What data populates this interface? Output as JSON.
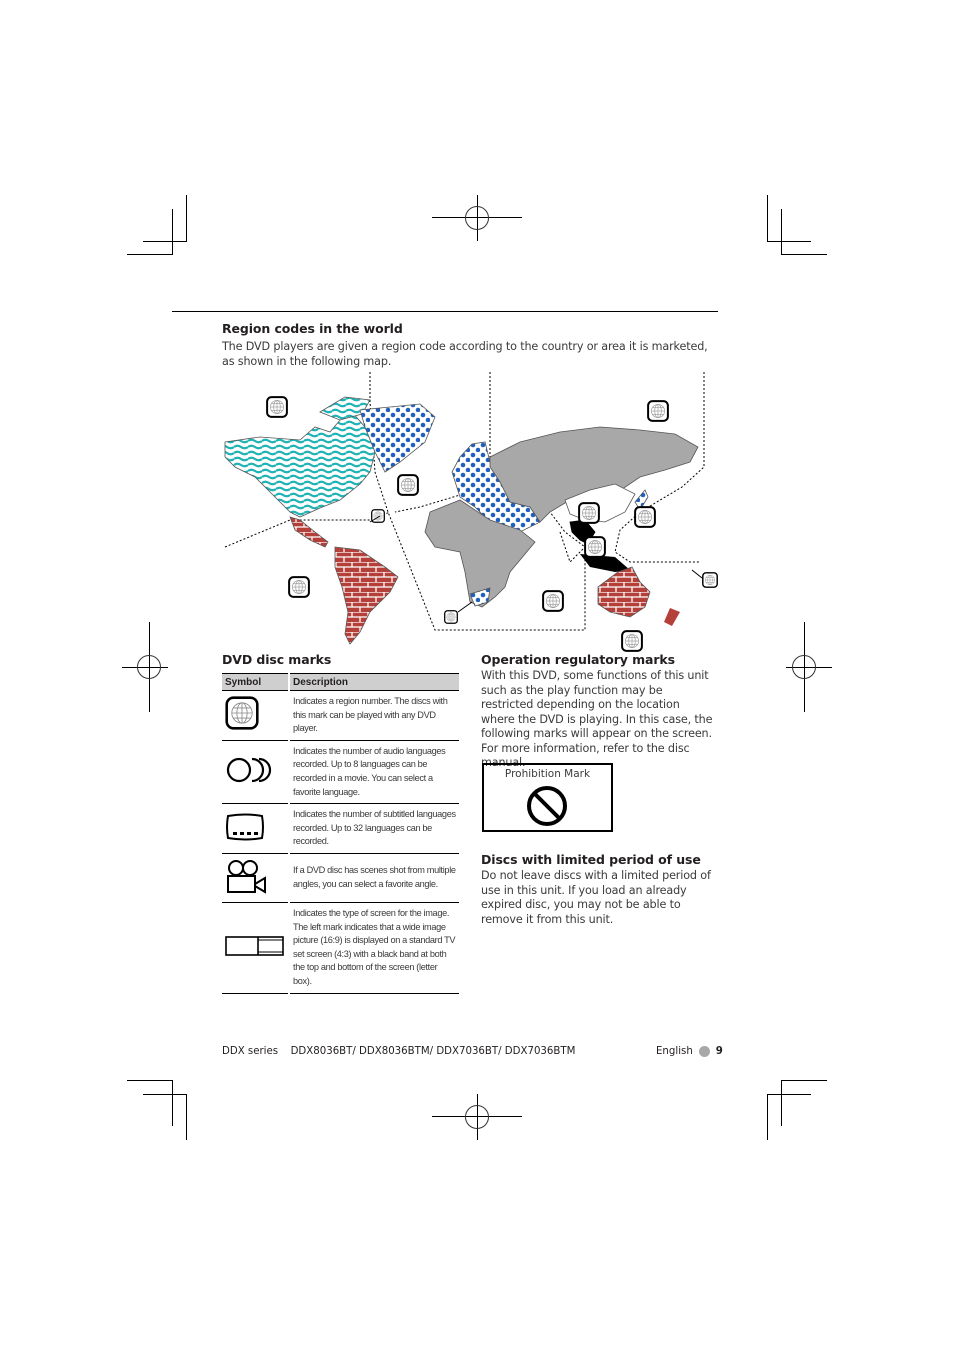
{
  "region_section": {
    "title": "Region codes in the world",
    "intro": "The DVD players are given a region code according to the country or area it is marketed, as shown in the following map."
  },
  "world_map": {
    "legend_colors": {
      "region1": "#1fb3b5",
      "region2": "#1f5fbf",
      "region3": "#000000",
      "region4": "#b5403a",
      "region5": "#a8a8a8",
      "region6": "#ffffff"
    },
    "region_markers": [
      {
        "region": "north-america"
      },
      {
        "region": "greenland"
      },
      {
        "region": "caribbean"
      },
      {
        "region": "south-america"
      },
      {
        "region": "europe"
      },
      {
        "region": "russia-north"
      },
      {
        "region": "china"
      },
      {
        "region": "southeast-asia"
      },
      {
        "region": "japan"
      },
      {
        "region": "south-africa"
      },
      {
        "region": "indian-ocean"
      },
      {
        "region": "pacific-islands"
      },
      {
        "region": "australia"
      }
    ]
  },
  "disc_marks": {
    "title": "DVD disc marks",
    "headers": {
      "symbol": "Symbol",
      "description": "Description"
    },
    "rows": [
      {
        "icon": "region-globe-icon",
        "description": "Indicates a region number. The discs with this mark can be played with any DVD player."
      },
      {
        "icon": "audio-languages-icon",
        "description": "Indicates the number of audio languages recorded. Up to 8 languages can be recorded in a movie. You can select a favorite language."
      },
      {
        "icon": "subtitle-languages-icon",
        "description": "Indicates the number of subtitled languages recorded. Up to 32 languages can be recorded."
      },
      {
        "icon": "multi-angle-camera-icon",
        "description": "If a DVD disc has scenes shot from multiple angles, you can select a favorite angle."
      },
      {
        "icon": "screen-type-icon",
        "description": "Indicates the type of screen for the image. The left mark indicates that a wide image picture (16:9) is displayed on a standard TV set screen (4:3) with a black band at both the top and bottom of the screen (letter box)."
      }
    ]
  },
  "operation_marks": {
    "title": "Operation regulatory marks",
    "body": "With this DVD, some functions of this unit such as the play function may be restricted depending on the location where the DVD is playing. In this case, the following marks will appear on the screen. For more information, refer to the disc manual.",
    "prohibition_label": "Prohibition Mark"
  },
  "limited_discs": {
    "title": "Discs with limited period of use",
    "body": "Do not leave discs with a limited period of use in this unit. If you load an already expired disc, you may not be able to remove it from this unit."
  },
  "footer": {
    "series": "DDX series",
    "models": "DDX8036BT/ DDX8036BTM/ DDX7036BT/ DDX7036BTM",
    "language": "English",
    "page_number": "9"
  }
}
